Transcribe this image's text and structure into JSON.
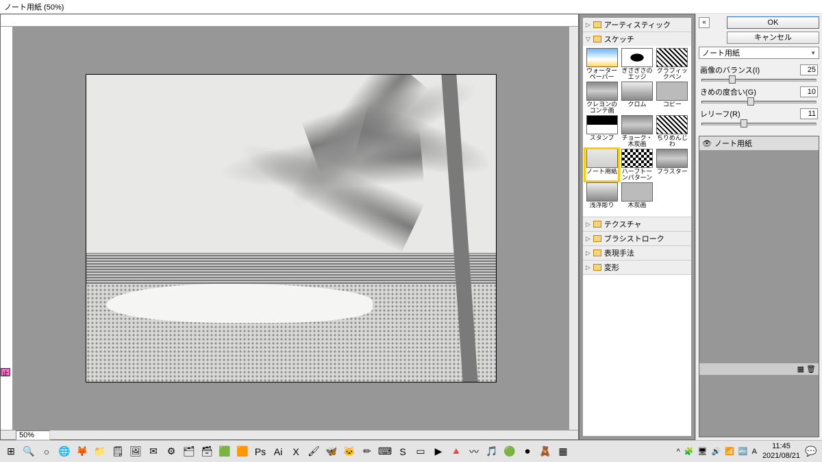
{
  "window": {
    "title": "ノート用紙 (50%)"
  },
  "zoom": "50%",
  "marker": "止",
  "categories": [
    {
      "name": "アーティスティック",
      "open": false
    },
    {
      "name": "スケッチ",
      "open": true,
      "filters": [
        {
          "label": "ウォーターペーパー",
          "cls": "ti-color"
        },
        {
          "label": "ぎざぎさのエッジ",
          "cls": "ti-bw1"
        },
        {
          "label": "グラフィックペン",
          "cls": "ti-bw2"
        },
        {
          "label": "クレヨンのコンテ画",
          "cls": "ti-gr1"
        },
        {
          "label": "クロム",
          "cls": "ti-gr2"
        },
        {
          "label": "コピー",
          "cls": "ti-gr3"
        },
        {
          "label": "スタンプ",
          "cls": "ti-st"
        },
        {
          "label": "チョーク・木炭画",
          "cls": "ti-gr1"
        },
        {
          "label": "ちりめんじわ",
          "cls": "ti-bw2"
        },
        {
          "label": "ノート用紙",
          "cls": "ti-sk",
          "selected": true
        },
        {
          "label": "ハーフトーンパターン",
          "cls": "ti-half"
        },
        {
          "label": "プラスター",
          "cls": "ti-gr1"
        },
        {
          "label": "浅浮彫り",
          "cls": "ti-gr2"
        },
        {
          "label": "木炭画",
          "cls": "ti-gr3"
        }
      ]
    },
    {
      "name": "テクスチャ",
      "open": false
    },
    {
      "name": "ブラシストローク",
      "open": false
    },
    {
      "name": "表現手法",
      "open": false
    },
    {
      "name": "変形",
      "open": false
    }
  ],
  "buttons": {
    "ok": "OK",
    "cancel": "キャンセル"
  },
  "filter_name": "ノート用紙",
  "params": [
    {
      "label": "画像のバランス(I)",
      "value": "25",
      "pos": 24
    },
    {
      "label": "きめの度合い(G)",
      "value": "10",
      "pos": 40
    },
    {
      "label": "レリーフ(R)",
      "value": "11",
      "pos": 34
    }
  ],
  "layer_item": "ノート用紙",
  "taskbar_icons": [
    "⊞",
    "🔍",
    "○",
    "🌐",
    "🦊",
    "📁",
    "🗒",
    "🖼",
    "✉",
    "⚙",
    "🗂",
    "🗃",
    "🟩",
    "🟧",
    "Ps",
    "Ai",
    "X",
    "🖌",
    "🦋",
    "🐱",
    "✏",
    "⌨",
    "S",
    "▭",
    "▶",
    "🔺",
    "〰",
    "🎵",
    "🟢",
    "⏺",
    "🧸",
    "▦"
  ],
  "tray_icons": [
    "^",
    "🧩",
    "🖥",
    "🔊",
    "📶",
    "🔤",
    "A"
  ],
  "clock": {
    "time": "11:45",
    "date": "2021/08/21"
  }
}
